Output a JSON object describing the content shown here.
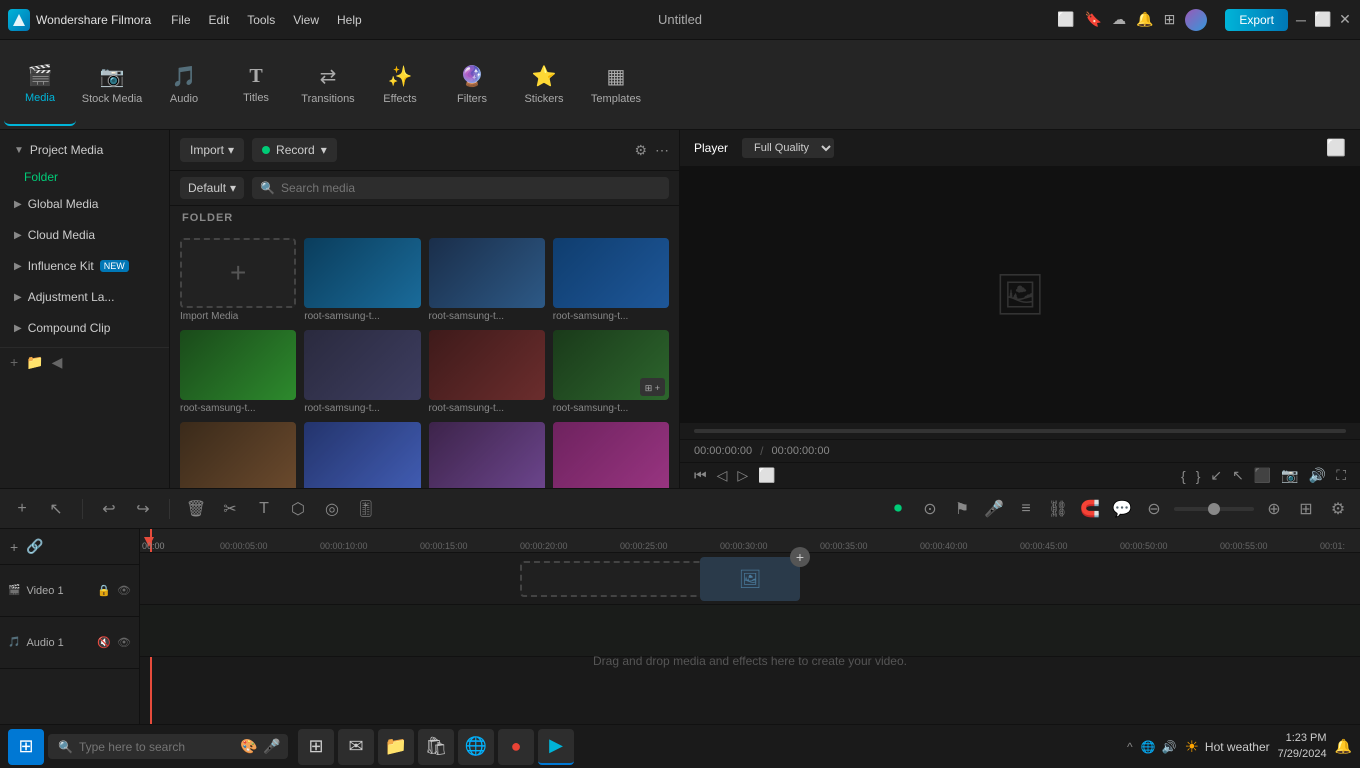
{
  "app": {
    "name": "Wondershare Filmora",
    "title": "Untitled",
    "logo_text": "Wondershare Filmora"
  },
  "menu": {
    "items": [
      "File",
      "Edit",
      "Tools",
      "View",
      "Help"
    ]
  },
  "toolbar": {
    "items": [
      {
        "id": "media",
        "label": "Media",
        "icon": "🎬",
        "active": true
      },
      {
        "id": "stock-media",
        "label": "Stock Media",
        "icon": "📷"
      },
      {
        "id": "audio",
        "label": "Audio",
        "icon": "🎵"
      },
      {
        "id": "titles",
        "label": "Titles",
        "icon": "T"
      },
      {
        "id": "transitions",
        "label": "Transitions",
        "icon": "⇄"
      },
      {
        "id": "effects",
        "label": "Effects",
        "icon": "✨"
      },
      {
        "id": "filters",
        "label": "Filters",
        "icon": "🔮"
      },
      {
        "id": "stickers",
        "label": "Stickers",
        "icon": "⭐"
      },
      {
        "id": "templates",
        "label": "Templates",
        "icon": "▦"
      }
    ],
    "export_label": "Export"
  },
  "left_panel": {
    "sections": [
      {
        "id": "project-media",
        "label": "Project Media",
        "expanded": true
      },
      {
        "id": "global-media",
        "label": "Global Media"
      },
      {
        "id": "cloud-media",
        "label": "Cloud Media"
      },
      {
        "id": "influence-kit",
        "label": "Influence Kit",
        "badge": "NEW"
      },
      {
        "id": "adjustment-la",
        "label": "Adjustment La..."
      },
      {
        "id": "compound-clip",
        "label": "Compound Clip"
      }
    ],
    "folder_label": "Folder"
  },
  "media_browser": {
    "import_label": "Import",
    "record_label": "Record",
    "default_label": "Default",
    "search_placeholder": "Search media",
    "folder_section": "FOLDER",
    "import_media_label": "Import Media",
    "thumbnails": [
      {
        "id": "t1",
        "name": "root-samsung-t...",
        "class": "t1"
      },
      {
        "id": "t2",
        "name": "root-samsung-t...",
        "class": "t2"
      },
      {
        "id": "t3",
        "name": "root-samsung-t...",
        "class": "t3"
      },
      {
        "id": "t4",
        "name": "root-samsung-t...",
        "class": "t4"
      },
      {
        "id": "t5",
        "name": "root-samsung-t...",
        "class": "t5"
      },
      {
        "id": "t6",
        "name": "root-samsung-t...",
        "class": "t6"
      },
      {
        "id": "t7",
        "name": "root-samsung-t...",
        "class": "t7"
      },
      {
        "id": "t8",
        "name": "root-samsung-t...",
        "class": "t8"
      }
    ]
  },
  "player": {
    "tab_player": "Player",
    "quality": "Full Quality",
    "time_current": "00:00:00:00",
    "time_total": "00:00:00:00"
  },
  "timeline": {
    "track_video_label": "Video 1",
    "track_audio_label": "Audio 1",
    "drag_hint": "Drag and drop media and effects here to create your video.",
    "ruler_marks": [
      "00:00",
      "00:00:05:00",
      "00:00:10:00",
      "00:00:15:00",
      "00:00:20:00",
      "00:00:25:00",
      "00:00:30:00",
      "00:00:35:00",
      "00:00:40:00",
      "00:00:45:00",
      "00:00:50:00",
      "00:00:55:00",
      "00:01:"
    ]
  },
  "taskbar": {
    "search_placeholder": "Type here to search",
    "weather_label": "Hot weather",
    "time": "1:23 PM",
    "date": "7/29/2024"
  }
}
